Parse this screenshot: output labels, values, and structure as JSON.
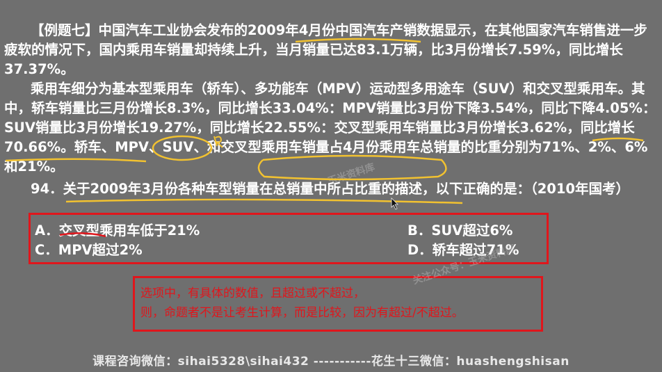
{
  "problem": {
    "para1": "【例题七】中国汽车工业协会发布的2009年4月份中国汽车产销数据显示，在其他国家汽车销售进一步疲软的情况下，国内乘用车销量却持续上升，当月销量已达83.1万辆，比3月份增长7.59%，同比增长37.37%。",
    "para2": "乘用车细分为基本型乘用车（轿车）、多功能车（MPV）运动型多用途车（SUV）和交叉型乘用车。其中，轿车销量比三月份增长8.3%，同比增长33.04%：MPV销量比3月份下降3.54%，同比下降4.05%：SUV销量比3月份增长19.27%，同比增长22.55%：交叉型乘用车销量比3月份增长3.62%，同比增长70.66%。轿车、MPV、SUV、和交叉型乘用车销量占4月份乘用车总销量的比重分别为71%、2%、6%和21%。",
    "question": "94．关于2009年3月份各种车型销量在总销量中所占比重的描述，以下正确的是：（2010年国考）"
  },
  "options": {
    "a": "A．交叉型乘用车低于21%",
    "b": "B．SUV超过6%",
    "c": "C．MPV超过2%",
    "d": "D．轿车超过71%"
  },
  "note": {
    "line1": "选项中，有具体的数值，且超过或不超过，",
    "line2": "则，命题者不是让考生计算，而是比较，因为有超过/不超过。"
  },
  "footer": {
    "text": "课程咨询微信：sihai5328\\sihai432  -----------花生十三微信：huashengshisan"
  },
  "watermarks": {
    "w1": "关注公众号：玉米资料库",
    "w2": "玉米资料库"
  },
  "colors": {
    "background": "#6f6f6f",
    "accent_red": "#e0161c",
    "annotation_yellow": "#f2c230"
  }
}
